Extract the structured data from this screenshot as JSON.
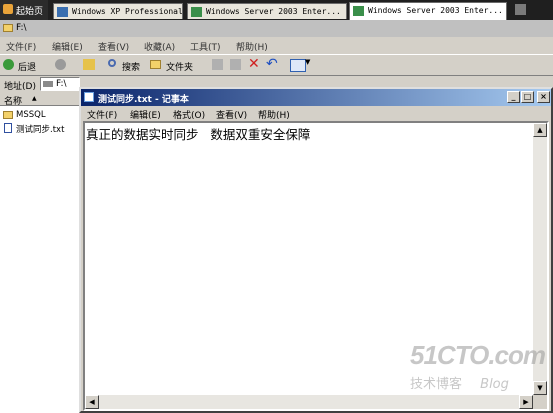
{
  "host_tabs": [
    {
      "label": "起始页",
      "active": false
    },
    {
      "label": "Windows XP Professional",
      "active": false
    },
    {
      "label": "Windows Server 2003 Enter...",
      "active": false
    },
    {
      "label": "Windows Server 2003 Enter...",
      "active": true
    }
  ],
  "explorer": {
    "title": "F:\\",
    "menu": [
      "文件(F)",
      "编辑(E)",
      "查看(V)",
      "收藏(A)",
      "工具(T)",
      "帮助(H)"
    ],
    "toolbar": {
      "back": "后退",
      "search": "搜索",
      "folders": "文件夹"
    },
    "address_label": "地址(D)",
    "address_value": "F:\\",
    "column_name": "名称",
    "files": [
      "MSSQL",
      "测试同步.txt"
    ]
  },
  "notepad": {
    "title": "测试同步.txt - 记事本",
    "menu": [
      "文件(F)",
      "编辑(E)",
      "格式(O)",
      "查看(V)",
      "帮助(H)"
    ],
    "content": "真正的数据实时同步   数据双重安全保障"
  },
  "watermark": {
    "line1": "51CTO.com",
    "line2": "技术博客",
    "line3": "Blog"
  },
  "colors": {
    "title_active": "#0a246a",
    "title_gradient_end": "#a6caf0",
    "face": "#d4d0c8"
  }
}
